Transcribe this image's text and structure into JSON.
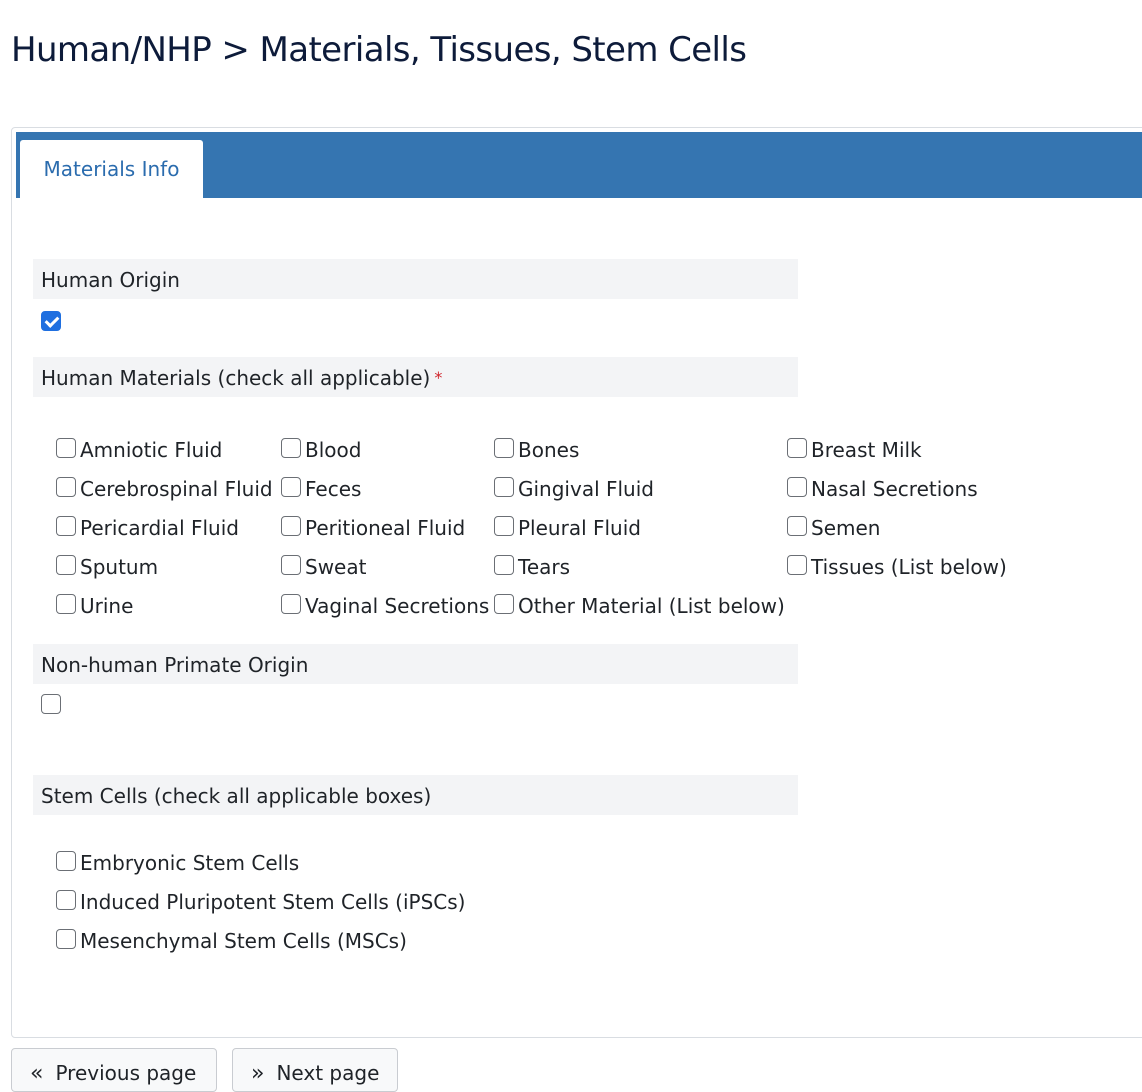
{
  "page": {
    "title": "Human/NHP > Materials, Tissues, Stem Cells"
  },
  "tabs": [
    {
      "label": "Materials Info",
      "active": true
    }
  ],
  "human_origin": {
    "label": "Human Origin",
    "checked": true
  },
  "human_materials": {
    "label": "Human Materials (check all applicable)",
    "required_marker": "*",
    "options": [
      {
        "label": "Amniotic Fluid",
        "checked": false
      },
      {
        "label": "Blood",
        "checked": false
      },
      {
        "label": "Bones",
        "checked": false
      },
      {
        "label": "Breast Milk",
        "checked": false
      },
      {
        "label": "Cerebrospinal Fluid",
        "checked": false
      },
      {
        "label": "Feces",
        "checked": false
      },
      {
        "label": "Gingival Fluid",
        "checked": false
      },
      {
        "label": "Nasal Secretions",
        "checked": false
      },
      {
        "label": "Pericardial Fluid",
        "checked": false
      },
      {
        "label": "Peritioneal Fluid",
        "checked": false
      },
      {
        "label": "Pleural Fluid",
        "checked": false
      },
      {
        "label": "Semen",
        "checked": false
      },
      {
        "label": "Sputum",
        "checked": false
      },
      {
        "label": "Sweat",
        "checked": false
      },
      {
        "label": "Tears",
        "checked": false
      },
      {
        "label": "Tissues (List below)",
        "checked": false
      },
      {
        "label": "Urine",
        "checked": false
      },
      {
        "label": "Vaginal Secretions",
        "checked": false
      },
      {
        "label": "Other Material (List below)",
        "checked": false
      }
    ]
  },
  "nhp_origin": {
    "label": "Non-human Primate Origin",
    "checked": false
  },
  "stem_cells": {
    "label": "Stem Cells (check all applicable boxes)",
    "options": [
      {
        "label": "Embryonic Stem Cells",
        "checked": false
      },
      {
        "label": "Induced Pluripotent Stem Cells (iPSCs)",
        "checked": false
      },
      {
        "label": "Mesenchymal Stem Cells (MSCs)",
        "checked": false
      }
    ]
  },
  "navigation": {
    "previous_label": "Previous page",
    "previous_icon": "double-chevron-left-icon",
    "next_label": "Next page",
    "next_icon": "double-chevron-right-icon"
  },
  "colors": {
    "tab_bar": "#3575b1",
    "tab_text": "#2b6cae",
    "checkbox_checked": "#1f6fe0",
    "required": "#d0242b",
    "section_bg": "#f3f4f6"
  }
}
